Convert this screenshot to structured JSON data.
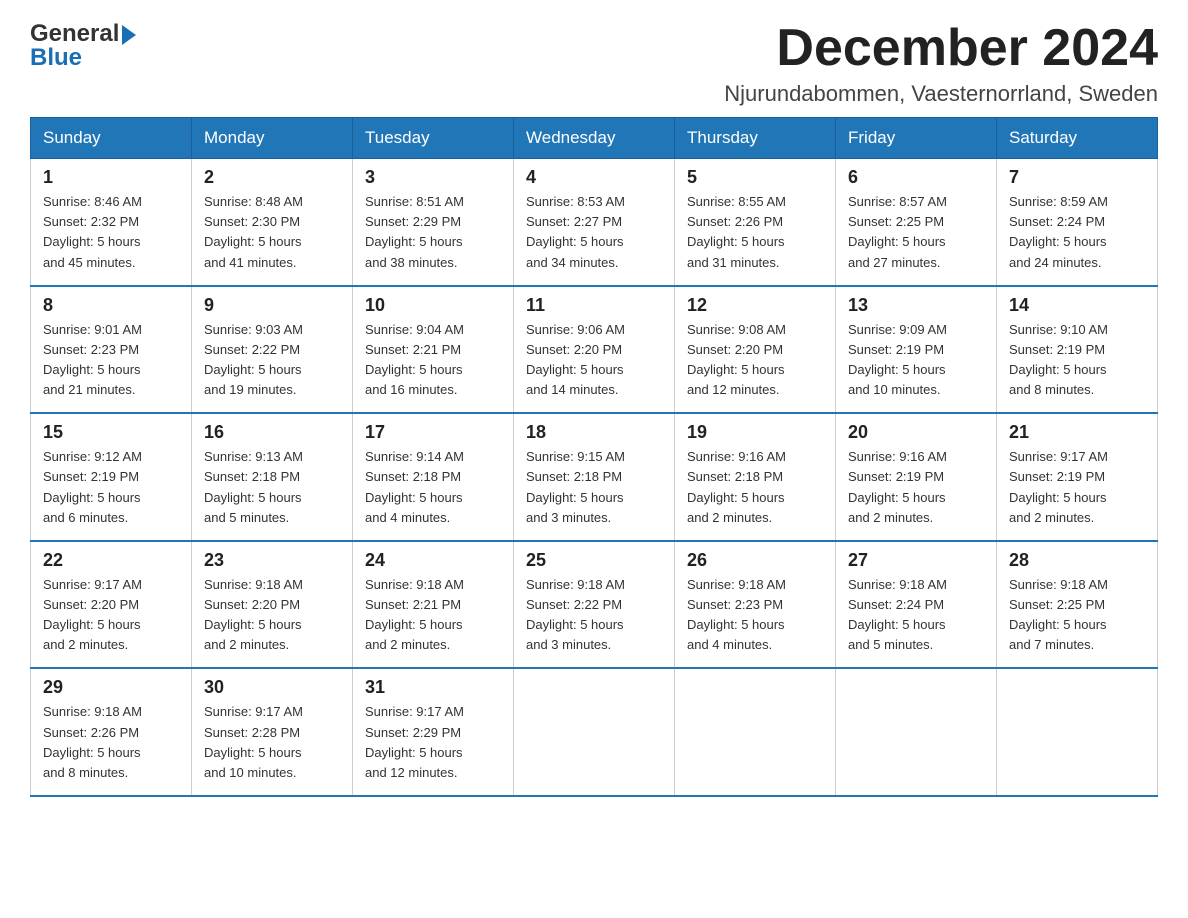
{
  "header": {
    "logo_general": "General",
    "logo_blue": "Blue",
    "month_title": "December 2024",
    "location": "Njurundabommen, Vaesternorrland, Sweden"
  },
  "weekdays": [
    "Sunday",
    "Monday",
    "Tuesday",
    "Wednesday",
    "Thursday",
    "Friday",
    "Saturday"
  ],
  "weeks": [
    [
      {
        "day": "1",
        "sunrise": "8:46 AM",
        "sunset": "2:32 PM",
        "daylight": "5 hours and 45 minutes."
      },
      {
        "day": "2",
        "sunrise": "8:48 AM",
        "sunset": "2:30 PM",
        "daylight": "5 hours and 41 minutes."
      },
      {
        "day": "3",
        "sunrise": "8:51 AM",
        "sunset": "2:29 PM",
        "daylight": "5 hours and 38 minutes."
      },
      {
        "day": "4",
        "sunrise": "8:53 AM",
        "sunset": "2:27 PM",
        "daylight": "5 hours and 34 minutes."
      },
      {
        "day": "5",
        "sunrise": "8:55 AM",
        "sunset": "2:26 PM",
        "daylight": "5 hours and 31 minutes."
      },
      {
        "day": "6",
        "sunrise": "8:57 AM",
        "sunset": "2:25 PM",
        "daylight": "5 hours and 27 minutes."
      },
      {
        "day": "7",
        "sunrise": "8:59 AM",
        "sunset": "2:24 PM",
        "daylight": "5 hours and 24 minutes."
      }
    ],
    [
      {
        "day": "8",
        "sunrise": "9:01 AM",
        "sunset": "2:23 PM",
        "daylight": "5 hours and 21 minutes."
      },
      {
        "day": "9",
        "sunrise": "9:03 AM",
        "sunset": "2:22 PM",
        "daylight": "5 hours and 19 minutes."
      },
      {
        "day": "10",
        "sunrise": "9:04 AM",
        "sunset": "2:21 PM",
        "daylight": "5 hours and 16 minutes."
      },
      {
        "day": "11",
        "sunrise": "9:06 AM",
        "sunset": "2:20 PM",
        "daylight": "5 hours and 14 minutes."
      },
      {
        "day": "12",
        "sunrise": "9:08 AM",
        "sunset": "2:20 PM",
        "daylight": "5 hours and 12 minutes."
      },
      {
        "day": "13",
        "sunrise": "9:09 AM",
        "sunset": "2:19 PM",
        "daylight": "5 hours and 10 minutes."
      },
      {
        "day": "14",
        "sunrise": "9:10 AM",
        "sunset": "2:19 PM",
        "daylight": "5 hours and 8 minutes."
      }
    ],
    [
      {
        "day": "15",
        "sunrise": "9:12 AM",
        "sunset": "2:19 PM",
        "daylight": "5 hours and 6 minutes."
      },
      {
        "day": "16",
        "sunrise": "9:13 AM",
        "sunset": "2:18 PM",
        "daylight": "5 hours and 5 minutes."
      },
      {
        "day": "17",
        "sunrise": "9:14 AM",
        "sunset": "2:18 PM",
        "daylight": "5 hours and 4 minutes."
      },
      {
        "day": "18",
        "sunrise": "9:15 AM",
        "sunset": "2:18 PM",
        "daylight": "5 hours and 3 minutes."
      },
      {
        "day": "19",
        "sunrise": "9:16 AM",
        "sunset": "2:18 PM",
        "daylight": "5 hours and 2 minutes."
      },
      {
        "day": "20",
        "sunrise": "9:16 AM",
        "sunset": "2:19 PM",
        "daylight": "5 hours and 2 minutes."
      },
      {
        "day": "21",
        "sunrise": "9:17 AM",
        "sunset": "2:19 PM",
        "daylight": "5 hours and 2 minutes."
      }
    ],
    [
      {
        "day": "22",
        "sunrise": "9:17 AM",
        "sunset": "2:20 PM",
        "daylight": "5 hours and 2 minutes."
      },
      {
        "day": "23",
        "sunrise": "9:18 AM",
        "sunset": "2:20 PM",
        "daylight": "5 hours and 2 minutes."
      },
      {
        "day": "24",
        "sunrise": "9:18 AM",
        "sunset": "2:21 PM",
        "daylight": "5 hours and 2 minutes."
      },
      {
        "day": "25",
        "sunrise": "9:18 AM",
        "sunset": "2:22 PM",
        "daylight": "5 hours and 3 minutes."
      },
      {
        "day": "26",
        "sunrise": "9:18 AM",
        "sunset": "2:23 PM",
        "daylight": "5 hours and 4 minutes."
      },
      {
        "day": "27",
        "sunrise": "9:18 AM",
        "sunset": "2:24 PM",
        "daylight": "5 hours and 5 minutes."
      },
      {
        "day": "28",
        "sunrise": "9:18 AM",
        "sunset": "2:25 PM",
        "daylight": "5 hours and 7 minutes."
      }
    ],
    [
      {
        "day": "29",
        "sunrise": "9:18 AM",
        "sunset": "2:26 PM",
        "daylight": "5 hours and 8 minutes."
      },
      {
        "day": "30",
        "sunrise": "9:17 AM",
        "sunset": "2:28 PM",
        "daylight": "5 hours and 10 minutes."
      },
      {
        "day": "31",
        "sunrise": "9:17 AM",
        "sunset": "2:29 PM",
        "daylight": "5 hours and 12 minutes."
      },
      null,
      null,
      null,
      null
    ]
  ],
  "labels": {
    "sunrise": "Sunrise: ",
    "sunset": "Sunset: ",
    "daylight": "Daylight: "
  }
}
